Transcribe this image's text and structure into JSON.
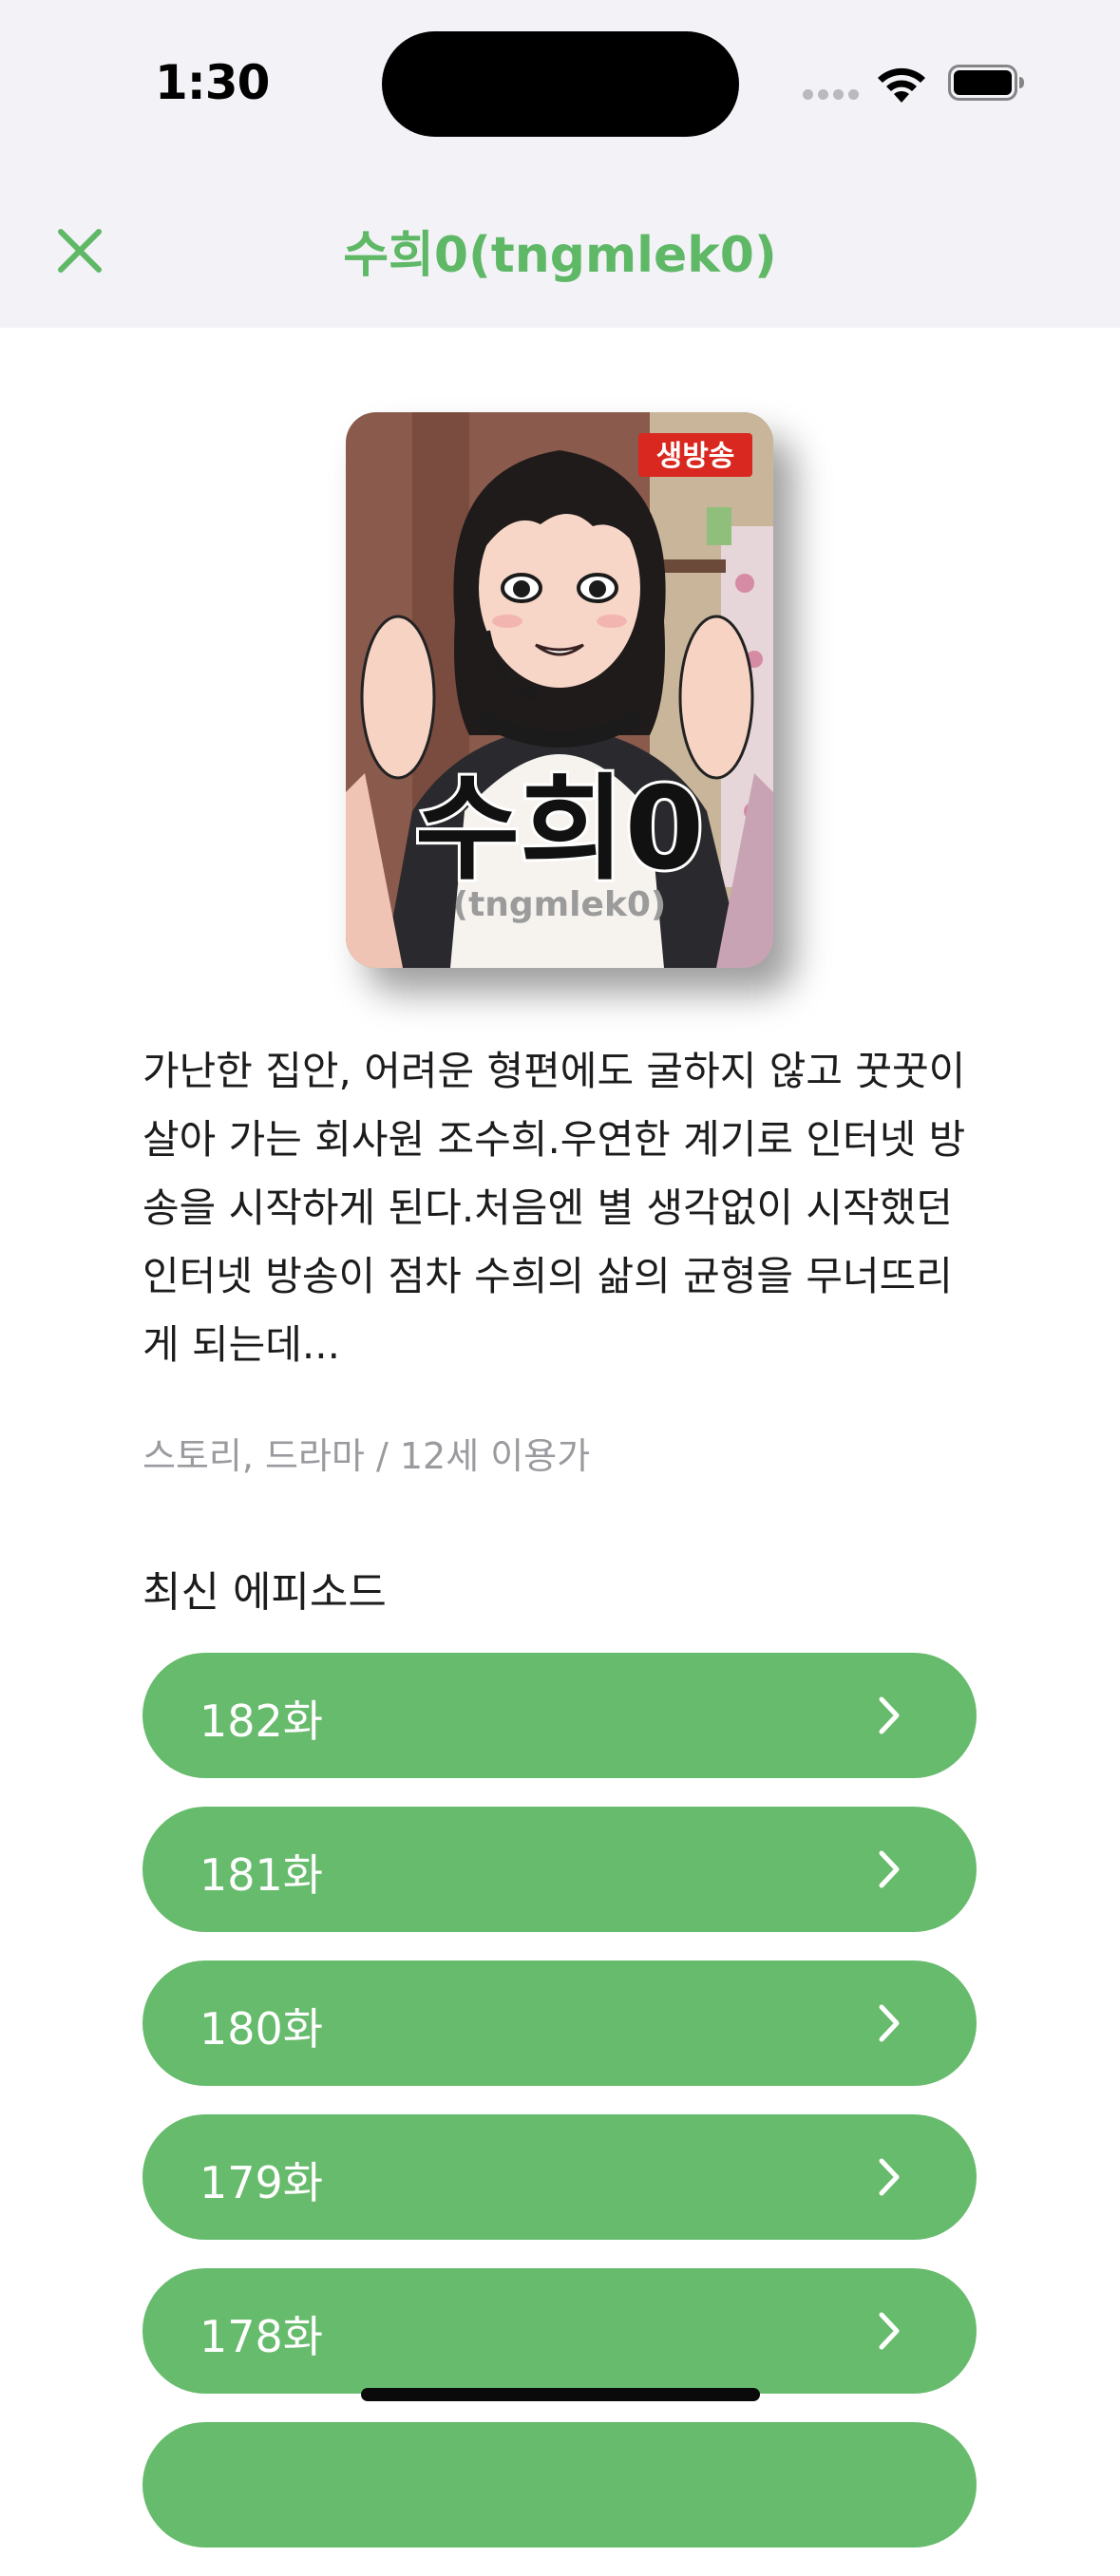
{
  "status_bar": {
    "time": "1:30"
  },
  "nav": {
    "title": "수희0(tngmlek0)"
  },
  "cover": {
    "badge": "생방송",
    "title_text": "수희0",
    "subtitle_text": "(tngmlek0)"
  },
  "description": "가난한 집안, 어려운 형편에도 굴하지 않고 꿋꿋이 살아 가는 회사원 조수희.우연한 계기로 인터넷 방송을 시작하게 된다.처음엔 별 생각없이 시작했던 인터넷 방송이 점차 수희의 삶의 균형을 무너뜨리게 되는데...",
  "meta": "스토리, 드라마 / 12세 이용가",
  "section_title": "최신 에피소드",
  "episodes": [
    {
      "label": "182화"
    },
    {
      "label": "181화"
    },
    {
      "label": "180화"
    },
    {
      "label": "179화"
    },
    {
      "label": "178화"
    }
  ],
  "colors": {
    "accent": "#5fb866",
    "button": "#67bb6c",
    "badge": "#d9281f"
  }
}
